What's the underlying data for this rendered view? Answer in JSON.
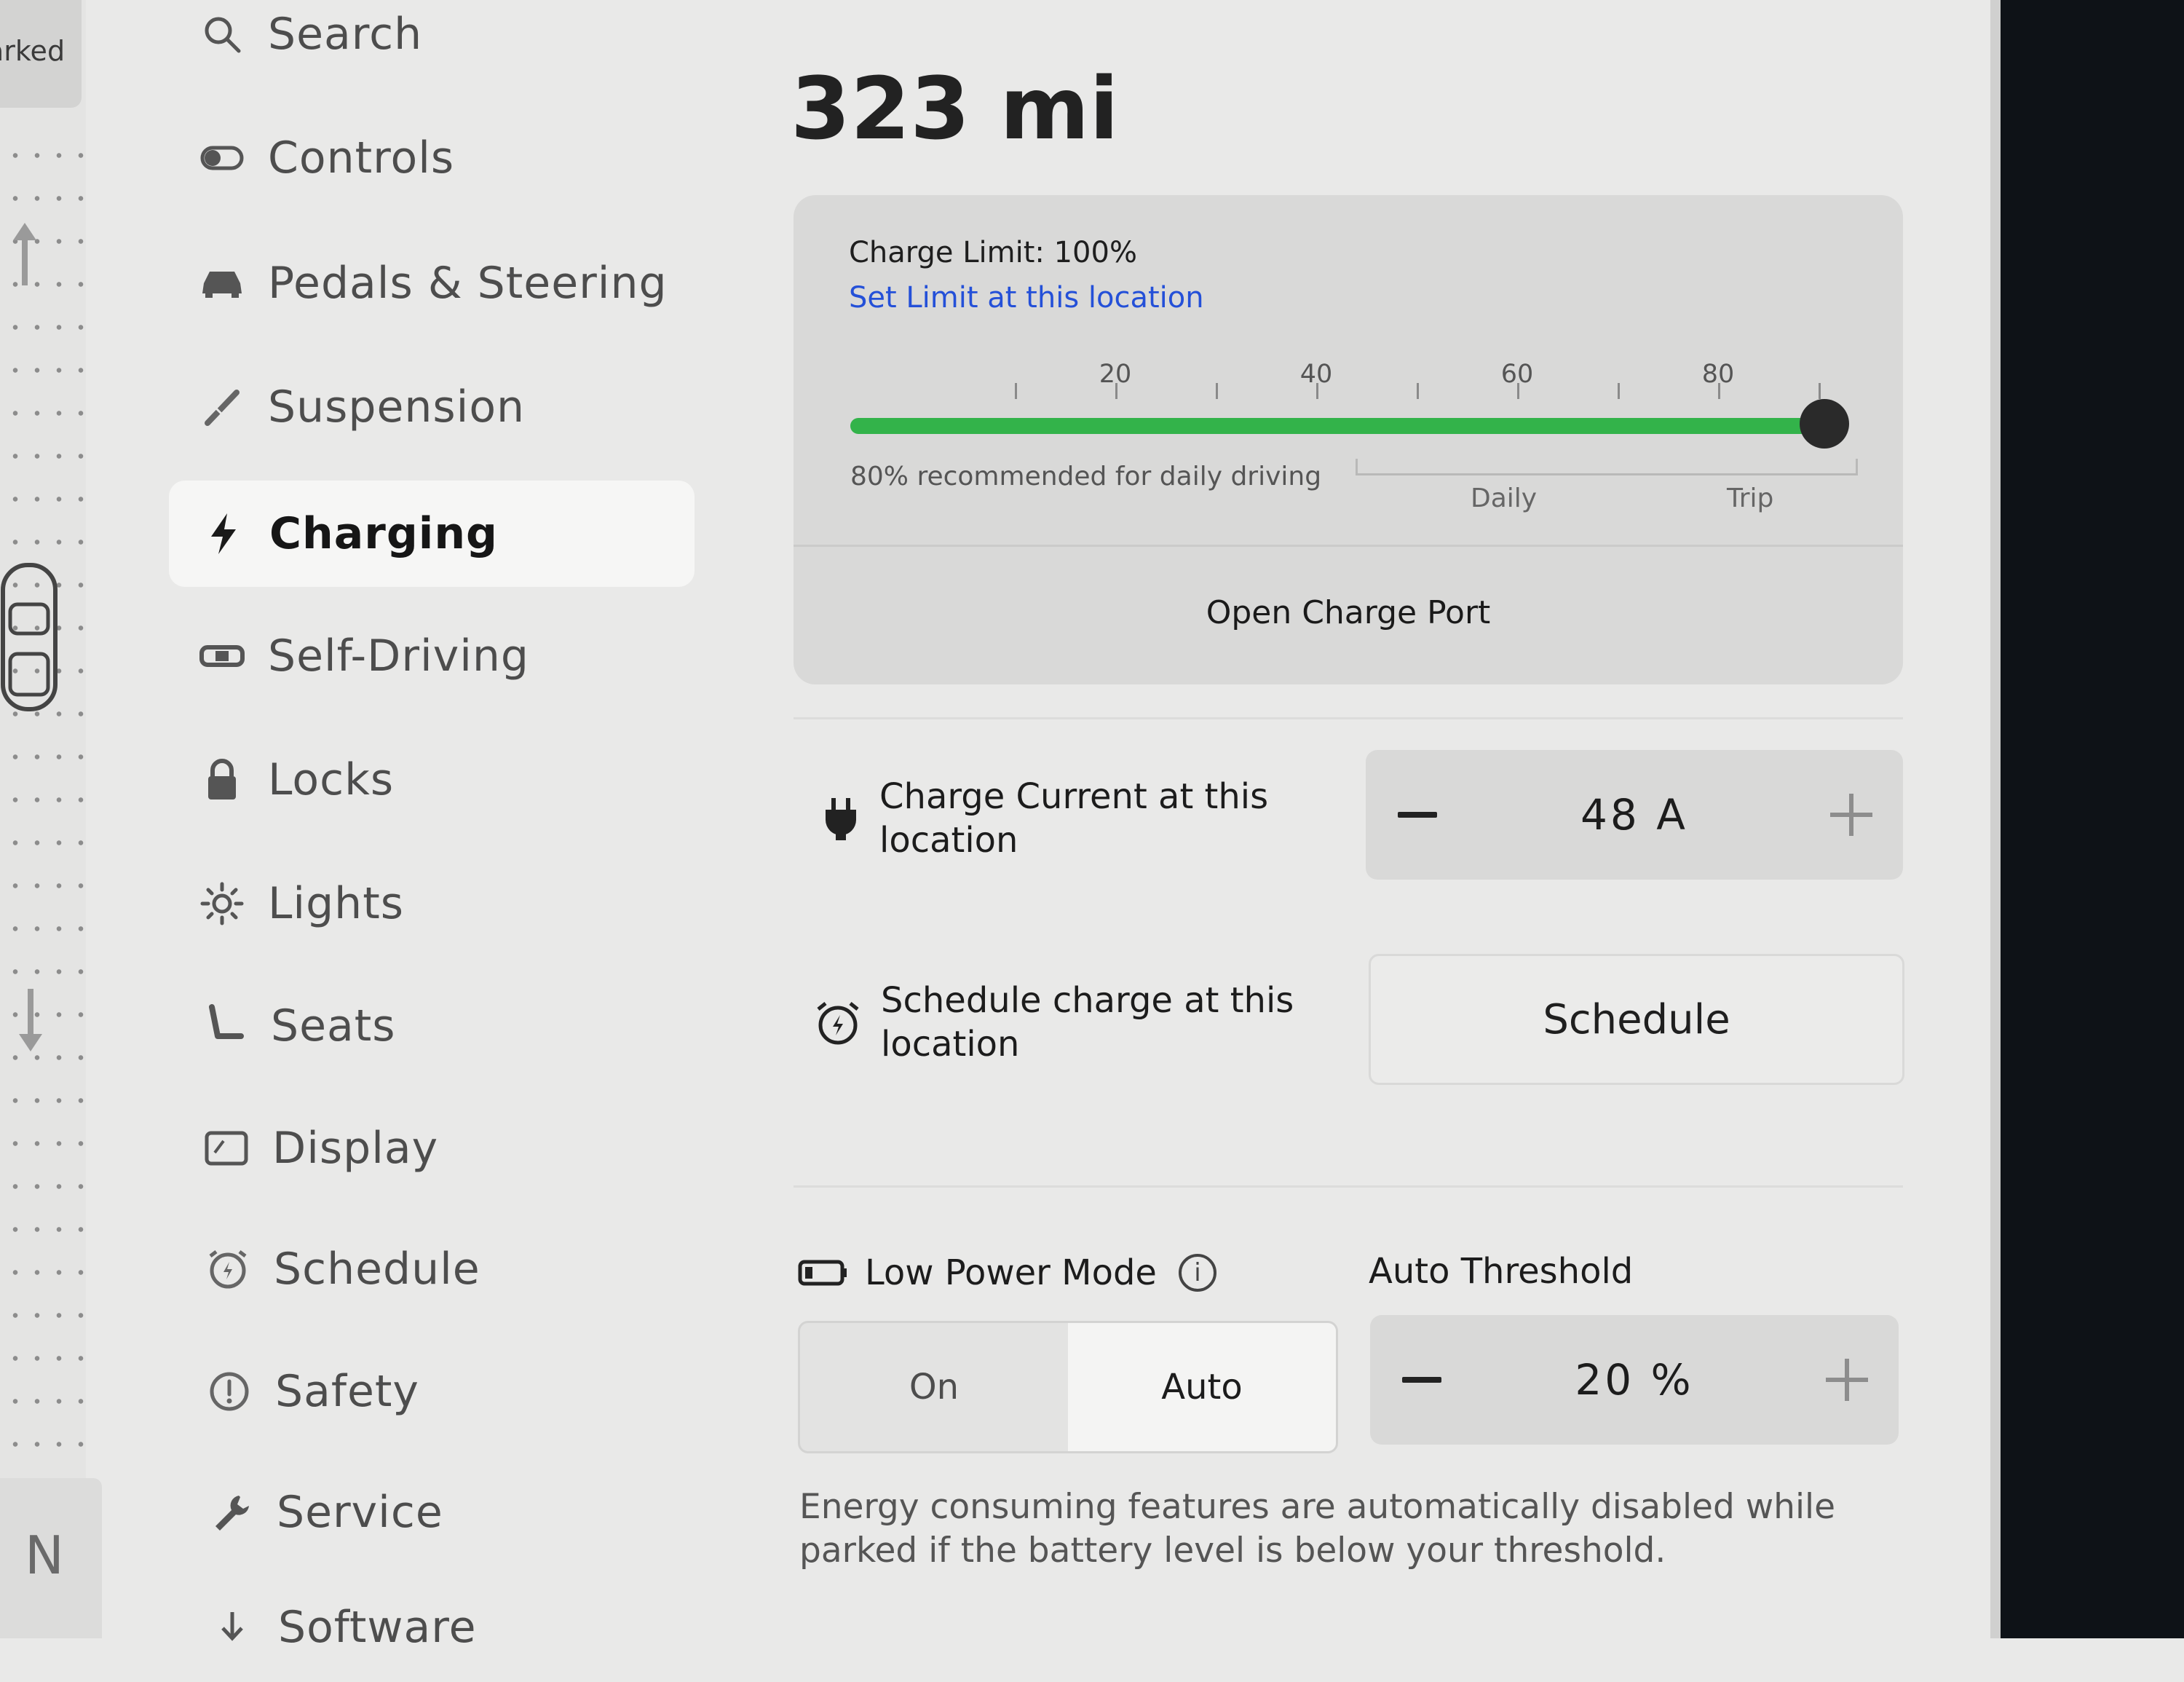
{
  "left_strip": {
    "status_text": "arked",
    "gear": "N"
  },
  "sidebar": {
    "items": [
      {
        "label": "Search",
        "icon": "search-icon"
      },
      {
        "label": "Controls",
        "icon": "toggle-icon"
      },
      {
        "label": "Pedals & Steering",
        "icon": "car-icon"
      },
      {
        "label": "Suspension",
        "icon": "wrench-pen-icon"
      },
      {
        "label": "Charging",
        "icon": "lightning-icon",
        "active": true
      },
      {
        "label": "Self-Driving",
        "icon": "steering-wheel-icon"
      },
      {
        "label": "Locks",
        "icon": "lock-icon"
      },
      {
        "label": "Lights",
        "icon": "sun-icon"
      },
      {
        "label": "Seats",
        "icon": "seat-icon"
      },
      {
        "label": "Display",
        "icon": "display-icon"
      },
      {
        "label": "Schedule",
        "icon": "alarm-clock-icon"
      },
      {
        "label": "Safety",
        "icon": "warning-icon"
      },
      {
        "label": "Service",
        "icon": "wrench-icon"
      },
      {
        "label": "Software",
        "icon": "download-icon"
      }
    ]
  },
  "main": {
    "range": "323 mi",
    "charge_card": {
      "limit_title": "Charge Limit: 100%",
      "limit_link": "Set Limit at this location",
      "ticks": [
        "20",
        "40",
        "60",
        "80"
      ],
      "limit_percent": 100,
      "recommendation": "80% recommended for daily driving",
      "daily_label": "Daily",
      "trip_label": "Trip",
      "open_port": "Open Charge Port"
    },
    "charge_current": {
      "label_line1": "Charge Current at this",
      "label_line2": "location",
      "value": "48 A"
    },
    "schedule_charge": {
      "label_line1": "Schedule charge at this",
      "label_line2": "location",
      "button": "Schedule"
    },
    "low_power": {
      "label": "Low Power Mode",
      "info": "i",
      "options": [
        "On",
        "Auto"
      ],
      "selected": "Auto"
    },
    "auto_threshold": {
      "label": "Auto Threshold",
      "value": "20 %"
    },
    "note": "Energy consuming features are automatically disabled while parked if the battery level is below your threshold."
  },
  "colors": {
    "accent_green": "#33b34a",
    "link_blue": "#2450d8",
    "background": "#e9e9e8"
  }
}
